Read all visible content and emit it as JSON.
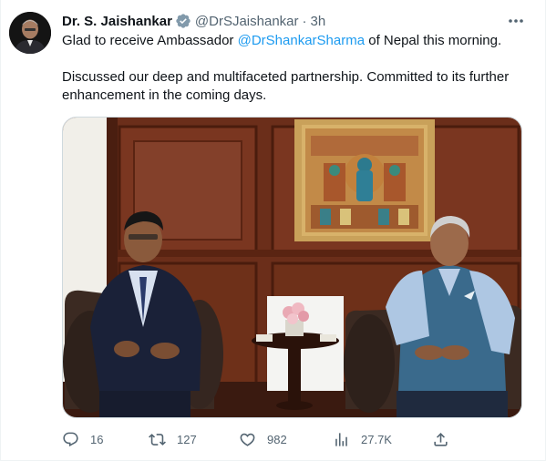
{
  "tweet": {
    "display_name": "Dr. S. Jaishankar",
    "handle": "@DrSJaishankar",
    "separator": "·",
    "time": "3h",
    "text_line1_pre": "Glad to receive Ambassador ",
    "mention": "@DrShankarSharma",
    "text_line1_post": " of Nepal this morning.",
    "text_para2": "Discussed our deep and multifaceted partnership. Committed to its further enhancement in the coming days."
  },
  "actions": {
    "replies": "16",
    "retweets": "127",
    "likes": "982",
    "views": "27.7K"
  },
  "colors": {
    "accent": "#1d9bf0",
    "secondary_text": "#536471",
    "primary_text": "#0f1419"
  },
  "icons": [
    "verified-icon",
    "more-icon",
    "reply-icon",
    "retweet-icon",
    "like-icon",
    "views-icon",
    "share-icon"
  ]
}
